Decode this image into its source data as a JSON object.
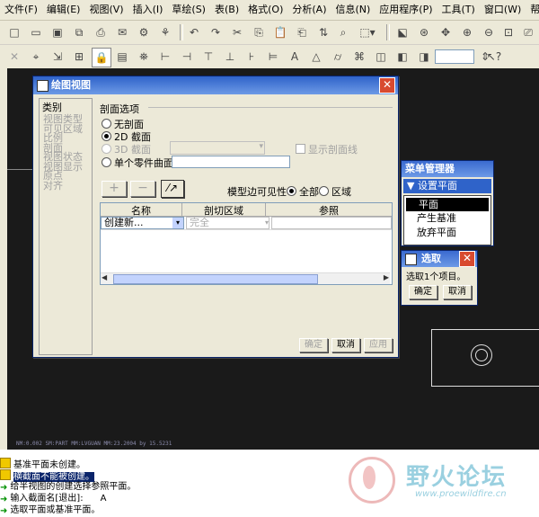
{
  "menubar": [
    "文件(F)",
    "编辑(E)",
    "视图(V)",
    "插入(I)",
    "草绘(S)",
    "表(B)",
    "格式(O)",
    "分析(A)",
    "信息(N)",
    "应用程序(P)",
    "工具(T)",
    "窗口(W)",
    "帮助(H)"
  ],
  "status_line": "NM:0.002   SM:PART  MM:LVGUAN  MM:23.2004 by 15.5231",
  "messages": [
    {
      "text": "基准平面未创建。",
      "icon": "info-icon",
      "highlight": false
    },
    {
      "text": "横截面不能被创建。",
      "icon": "warning-icon",
      "highlight": true
    },
    {
      "text": "给半视图的创建选择参照平面。",
      "icon": "arrow-icon",
      "highlight": false
    },
    {
      "text": "输入截面名[退出]:      A",
      "icon": "arrow-icon",
      "highlight": false
    },
    {
      "text": "选取平面或基准平面。",
      "icon": "arrow-icon",
      "highlight": false
    }
  ],
  "watermark": {
    "title": "野火论坛",
    "url": "www.proewildfire.cn"
  },
  "dialog": {
    "title": "绘图视图",
    "category_header": "类别",
    "categories": [
      "视图类型",
      "可见区域",
      "比例",
      "剖面",
      "视图状态",
      "视图显示",
      "原点",
      "对齐"
    ],
    "section_options_label": "剖面选项",
    "options": [
      {
        "label": "无剖面",
        "selected": false,
        "enabled": true
      },
      {
        "label": "2D 截面",
        "selected": true,
        "enabled": true
      },
      {
        "label": "3D 截面",
        "selected": false,
        "enabled": false
      },
      {
        "label": "单个零件曲面",
        "selected": false,
        "enabled": true
      }
    ],
    "show_xhatch_label": "显示剖面线",
    "model_edge_visibility_label": "模型边可见性",
    "edge_visibility": [
      {
        "label": "全部",
        "selected": true
      },
      {
        "label": "区域",
        "selected": false
      }
    ],
    "add_button": "+",
    "remove_button": "−",
    "table": {
      "columns": [
        "名称",
        "剖切区域",
        "参照"
      ],
      "rows": [
        {
          "name": "创建新...",
          "area": "完全",
          "ref": ""
        }
      ]
    },
    "scroll_label": "III",
    "buttons": {
      "ok": "确定",
      "cancel": "取消",
      "apply": "应用"
    }
  },
  "menu_manager": {
    "title": "菜单管理器",
    "header": "▼ 设置平面",
    "items": [
      {
        "label": "平面",
        "selected": true
      },
      {
        "label": "产生基准",
        "selected": false
      },
      {
        "label": "放弃平面",
        "selected": false
      }
    ]
  },
  "select_panel": {
    "title": "选取",
    "message": "选取1个项目。",
    "ok": "确定",
    "cancel": "取消"
  },
  "colors": {
    "title_bar": "#2f63c9",
    "graphics_bg": "#1a1a1a",
    "highlight": "#0a246a",
    "close": "#d84a30"
  }
}
